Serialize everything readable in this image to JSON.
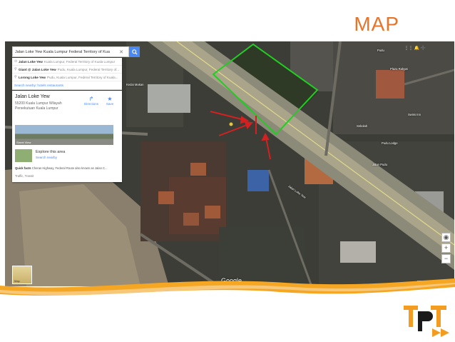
{
  "slide": {
    "title": "MAP"
  },
  "search": {
    "value": "Jalan Loke Yew Kuala Lumpur Federal Territory of Kua",
    "clear_icon": "close-icon",
    "button_icon": "search-icon"
  },
  "suggestions": [
    {
      "bold": "Jalan Loke Yew",
      "sub": "Kuala Lumpur, Federal Territory of Kuala Lumpur"
    },
    {
      "bold": "Giant @ Jalan Loke Yew",
      "sub": "Pudu, Kuala Lumpur, Federal Territory of..."
    },
    {
      "bold": "Lorong Loke Yew",
      "sub": "Pudu, Kuala Lumpur, Federal Territory of Kuala..."
    }
  ],
  "nearby": "Search nearby: hotels restaurants",
  "place": {
    "name": "Jalan Loke Yew",
    "address": "55200 Kuala Lumpur Wilayah Persekutuan Kuala Lumpur",
    "directions": "Directions",
    "save": "Save",
    "street_view": "Street View",
    "explore_title": "Explore this area",
    "explore_link": "Search nearby",
    "facts_label": "Quick facts",
    "facts": "Cheras Highway, Federal Route also known as Jalan C...",
    "traffic": "Traffic, Transit"
  },
  "map": {
    "google": "Google",
    "earth_label": "Map",
    "labels": [
      "Pudu",
      "Jalan Loke Yew",
      "Kedai Makan",
      "Pudu Lodge",
      "Plaza Rakyat",
      "Sekolah",
      "Swiss Inn",
      "Jalan Pudu"
    ],
    "zoom_in": "+",
    "zoom_out": "−"
  },
  "colors": {
    "title": "#e8742a",
    "highlight": "#22cc22",
    "arrows": "#d42020",
    "search_button": "#4a89f3"
  }
}
